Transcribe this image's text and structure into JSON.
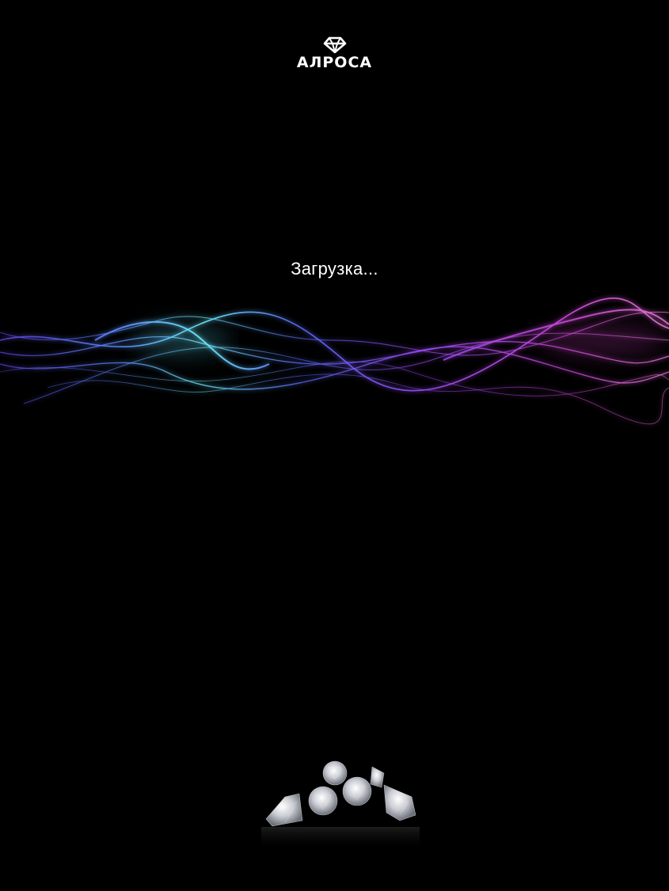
{
  "logo": {
    "text": "АЛРОСА",
    "icon": "alrosa-diamond-logo"
  },
  "status": {
    "loading_text": "Загрузка..."
  },
  "decor": {
    "wave": "light-wave-graphic",
    "gems": "diamonds-graphic"
  },
  "colors": {
    "background": "#000000",
    "text": "#ffffff",
    "wave_cyan": "#5fe3ff",
    "wave_blue": "#5b6cff",
    "wave_violet": "#9b4dff",
    "wave_pink": "#e24bd6"
  }
}
